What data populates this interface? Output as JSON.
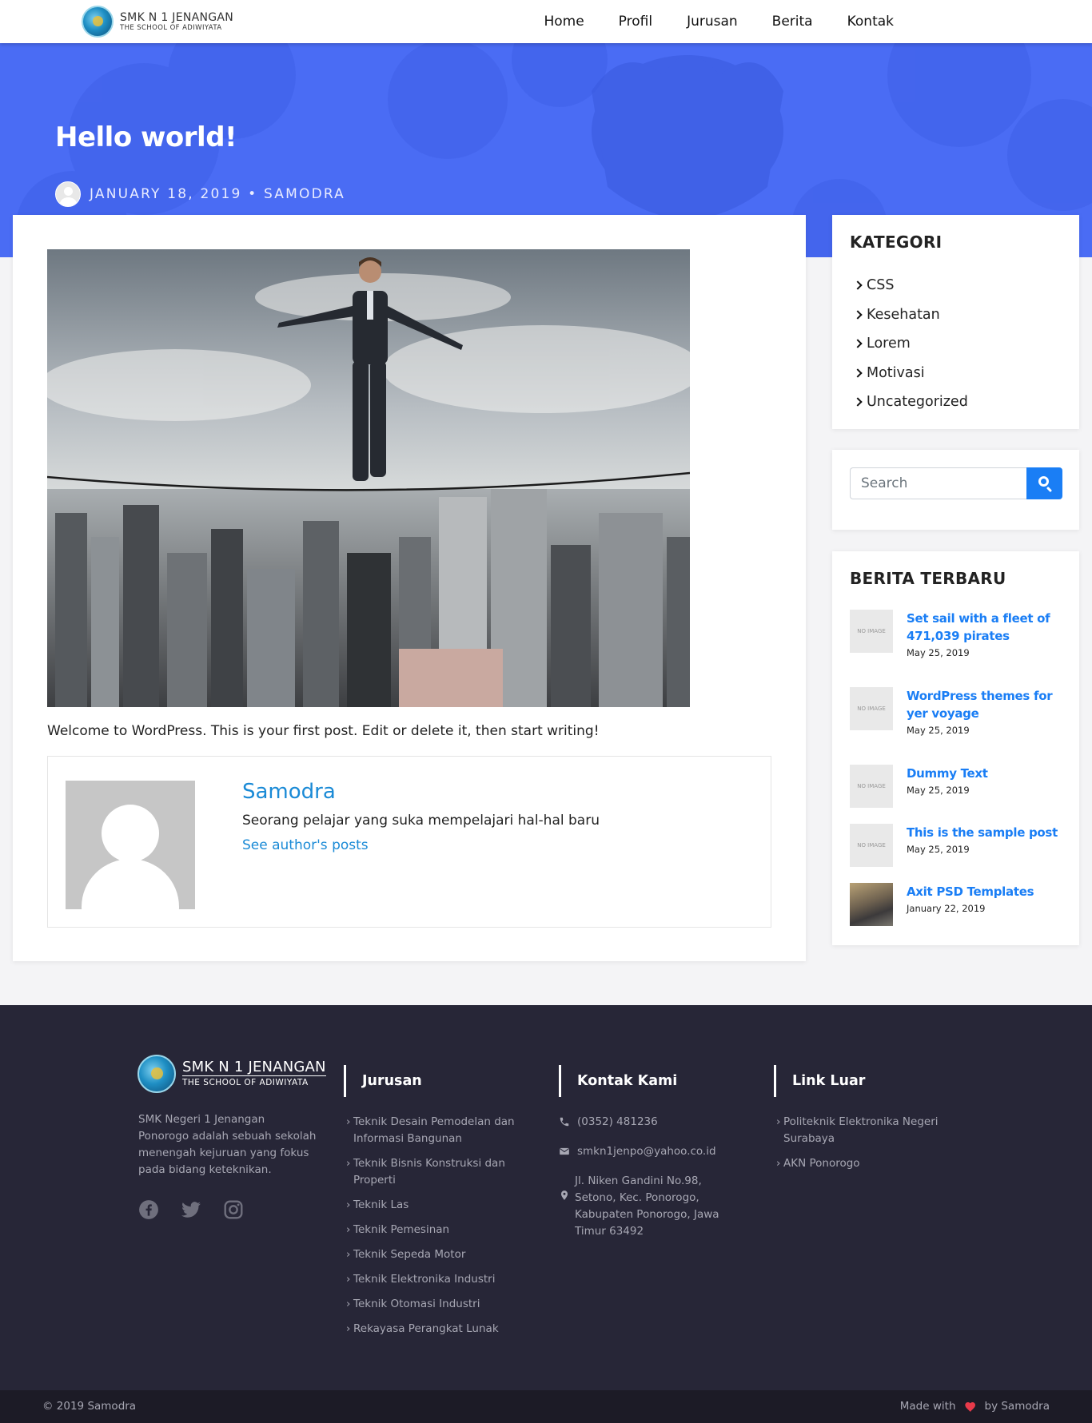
{
  "brand": {
    "name": "SMK N 1 JENANGAN",
    "tagline": "THE SCHOOL OF ADIWIYATA"
  },
  "nav": {
    "items": [
      "Home",
      "Profil",
      "Jurusan",
      "Berita",
      "Kontak"
    ]
  },
  "hero": {
    "title": "Hello world!",
    "meta": "JANUARY 18, 2019 • SAMODRA",
    "background": "#4a6cf4"
  },
  "post": {
    "body": "Welcome to WordPress. This is your first post. Edit or delete it, then start writing!",
    "author": {
      "name": "Samodra",
      "bio": "Seorang pelajar yang suka mempelajari hal-hal baru",
      "link": "See author's posts"
    }
  },
  "sidebar": {
    "kategori": {
      "title": "KATEGORI",
      "items": [
        "CSS",
        "Kesehatan",
        "Lorem",
        "Motivasi",
        "Uncategorized"
      ]
    },
    "search": {
      "placeholder": "Search"
    },
    "berita": {
      "title": "BERITA TERBARU",
      "items": [
        {
          "title": "Set sail with a fleet of 471,039 pirates",
          "date": "May 25, 2019",
          "thumb": "NO IMAGE"
        },
        {
          "title": "WordPress themes for yer voyage",
          "date": "May 25, 2019",
          "thumb": "NO IMAGE"
        },
        {
          "title": "Dummy Text",
          "date": "May 25, 2019",
          "thumb": "NO IMAGE"
        },
        {
          "title": "This is the sample post",
          "date": "May 25, 2019",
          "thumb": "NO IMAGE"
        },
        {
          "title": "Axit PSD Templates",
          "date": "January 22, 2019",
          "thumb": ""
        }
      ]
    }
  },
  "footer": {
    "about": "SMK Negeri 1 Jenangan Ponorogo adalah sebuah sekolah menengah kejuruan yang fokus pada bidang keteknikan.",
    "jurusan": {
      "title": "Jurusan",
      "items": [
        "Teknik Desain Pemodelan dan Informasi Bangunan",
        "Teknik Bisnis Konstruksi dan Properti",
        "Teknik Las",
        "Teknik Pemesinan",
        "Teknik Sepeda Motor",
        "Teknik Elektronika Industri",
        "Teknik Otomasi Industri",
        "Rekayasa Perangkat Lunak"
      ]
    },
    "kontak": {
      "title": "Kontak Kami",
      "phone": "(0352) 481236",
      "email": "smkn1jenpo@yahoo.co.id",
      "address": "Jl. Niken Gandini No.98, Setono, Kec. Ponorogo, Kabupaten Ponorogo, Jawa Timur 63492"
    },
    "links": {
      "title": "Link Luar",
      "items": [
        "Politeknik Elektronika Negeri Surabaya",
        "AKN Ponorogo"
      ]
    },
    "copyright": "© 2019 Samodra",
    "made_with_prefix": "Made with",
    "made_with_suffix": "by Samodra"
  },
  "colors": {
    "accent": "#1a7ef5",
    "link": "#1a8ad6",
    "footer_bg": "#272637",
    "heart": "#e83a4a"
  }
}
